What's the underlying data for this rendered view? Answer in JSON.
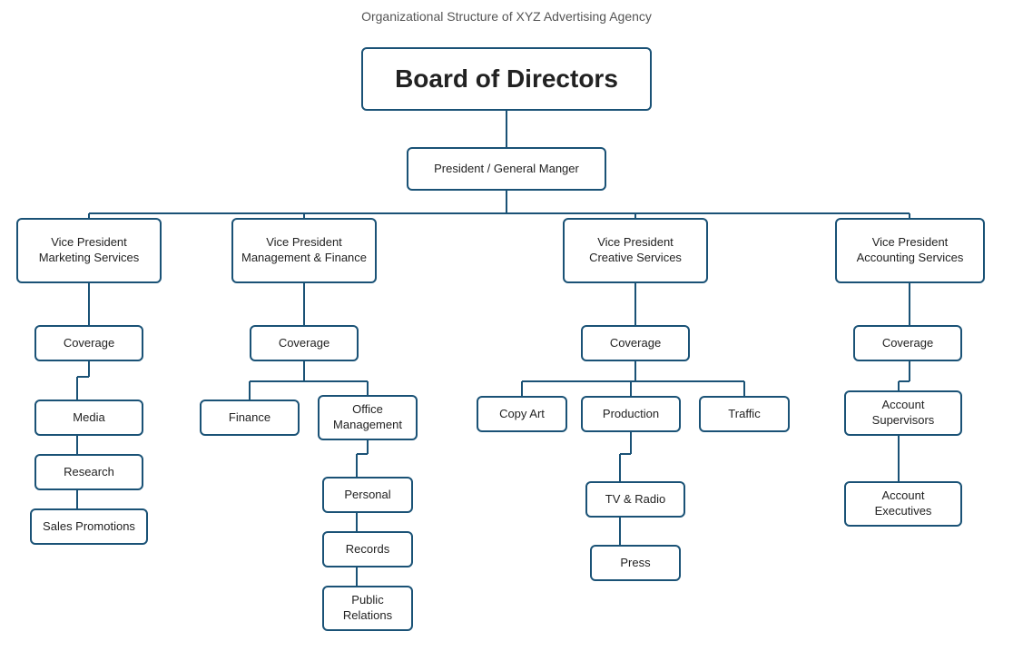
{
  "title": "Organizational Structure of XYZ Advertising Agency",
  "nodes": {
    "board": "Board of Directors",
    "president": "President / General Manger",
    "vp_marketing": "Vice President\nMarketing Services",
    "vp_mgmt": "Vice President\nManagement & Finance",
    "vp_creative": "Vice President\nCreative Services",
    "vp_accounting": "Vice President\nAccounting Services",
    "cov_marketing": "Coverage",
    "cov_mgmt": "Coverage",
    "cov_creative": "Coverage",
    "cov_accounting": "Coverage",
    "media": "Media",
    "research": "Research",
    "sales": "Sales Promotions",
    "finance": "Finance",
    "office_mgmt": "Office\nManagement",
    "personal": "Personal",
    "records": "Records",
    "public_relations": "Public\nRelations",
    "copy_art": "Copy Art",
    "production": "Production",
    "traffic": "Traffic",
    "tv_radio": "TV & Radio",
    "press": "Press",
    "acct_supervisors": "Account\nSupervisors",
    "acct_executives": "Account\nExecutives"
  }
}
